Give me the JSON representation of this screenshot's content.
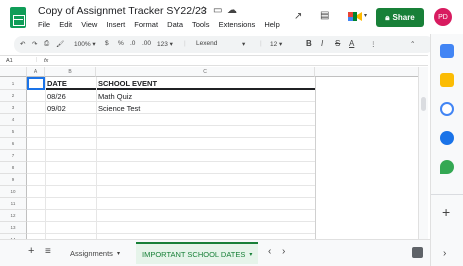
{
  "app": {
    "doc_title": "Copy of Assignmet Tracker SY22/23",
    "menu": [
      "File",
      "Edit",
      "View",
      "Insert",
      "Format",
      "Data",
      "Tools",
      "Extensions",
      "Help"
    ],
    "share_label": "Share",
    "avatar_initials": "PD",
    "colors": {
      "share_bg": "#188038",
      "avatar_bg": "#d81b60",
      "selection": "#1a73e8"
    }
  },
  "toolbar": {
    "zoom": "100%",
    "currency": "$",
    "percent": "%",
    "decimal_less": ".0",
    "decimal_more": ".00",
    "more_formats": "123",
    "font": "Lexend",
    "font_size": "12",
    "bold": "B",
    "italic": "I",
    "strike": "S",
    "text_color": "A"
  },
  "formula": {
    "cell_ref": "A1",
    "fx": "fx"
  },
  "grid": {
    "columns": [
      "A",
      "B",
      "C"
    ],
    "rows": [
      "1",
      "2",
      "3",
      "4",
      "5",
      "6",
      "7",
      "8",
      "9",
      "10",
      "11",
      "12",
      "13",
      "14"
    ],
    "header": {
      "date": "DATE",
      "event": "SCHOOL EVENT"
    },
    "entries": [
      {
        "date": "08/26",
        "event": "Math Quiz"
      },
      {
        "date": "09/02",
        "event": "Science Test"
      }
    ]
  },
  "sheets": {
    "tabs": [
      {
        "label": "Assignments",
        "active": false
      },
      {
        "label": "IMPORTANT SCHOOL DATES",
        "active": true
      }
    ]
  }
}
